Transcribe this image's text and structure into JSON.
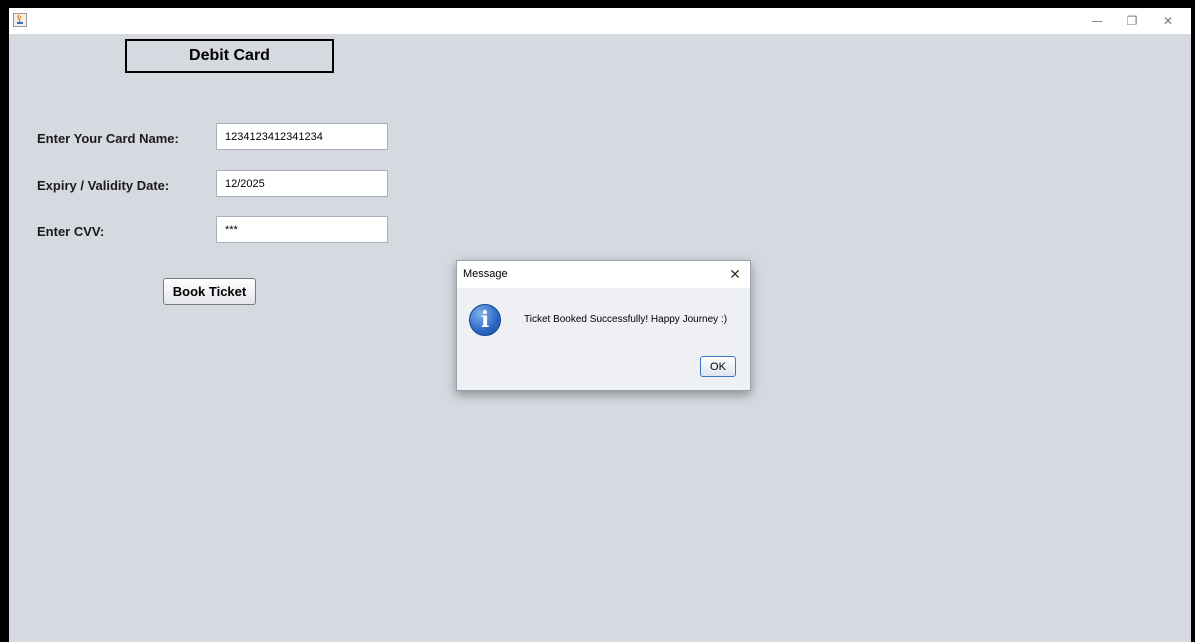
{
  "window": {
    "title_icon": "java-icon",
    "controls": {
      "minimize": "—",
      "maximize": "❐",
      "close": "✕"
    }
  },
  "form": {
    "heading": "Debit Card",
    "fields": [
      {
        "label": "Enter Your Card Name:",
        "value": "1234123412341234"
      },
      {
        "label": "Expiry / Validity Date:",
        "value": "12/2025"
      },
      {
        "label": "Enter CVV:",
        "value": "***"
      }
    ],
    "submit_label": "Book Ticket"
  },
  "dialog": {
    "title": "Message",
    "close_glyph": "✕",
    "icon": "info-icon",
    "icon_glyph": "i",
    "message": "Ticket Booked Successfully! Happy Journey :)",
    "ok_label": "OK"
  }
}
